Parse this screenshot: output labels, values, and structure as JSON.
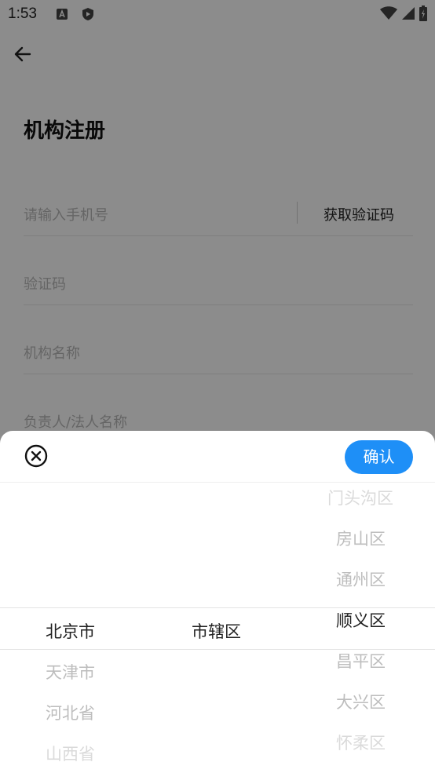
{
  "status": {
    "time": "1:53"
  },
  "page": {
    "title": "机构注册",
    "phone_placeholder": "请输入手机号",
    "get_code_label": "获取验证码",
    "code_placeholder": "验证码",
    "org_name_placeholder": "机构名称",
    "legal_person_placeholder": "负责人/法人名称"
  },
  "picker": {
    "confirm_label": "确认",
    "province": {
      "selected": "北京市",
      "below": [
        "天津市",
        "河北省",
        "山西省"
      ]
    },
    "city": {
      "selected": "市辖区"
    },
    "district": {
      "above": [
        "门头沟区",
        "房山区",
        "通州区"
      ],
      "selected": "顺义区",
      "below": [
        "昌平区",
        "大兴区",
        "怀柔区"
      ]
    }
  },
  "colors": {
    "accent": "#1e8ff7"
  }
}
